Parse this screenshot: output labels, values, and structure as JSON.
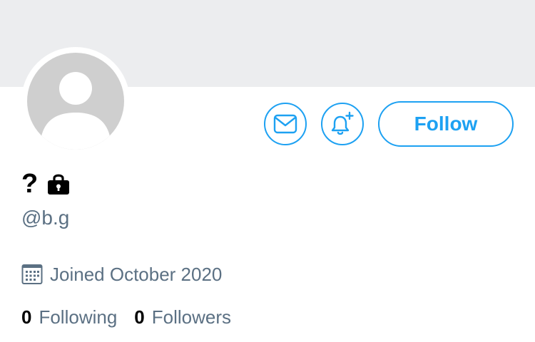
{
  "profile": {
    "display_name": "?",
    "handle": "@b.g",
    "joined": "Joined October 2020",
    "following_count": "0",
    "following_label": "Following",
    "followers_count": "0",
    "followers_label": "Followers"
  },
  "actions": {
    "follow_label": "Follow",
    "message_icon": "mail-icon",
    "notify_icon": "bell-plus-icon"
  },
  "colors": {
    "accent": "#1da1f2",
    "secondary_text": "#5b7083",
    "banner": "#ecedef",
    "avatar_placeholder": "#cfcfcf"
  }
}
